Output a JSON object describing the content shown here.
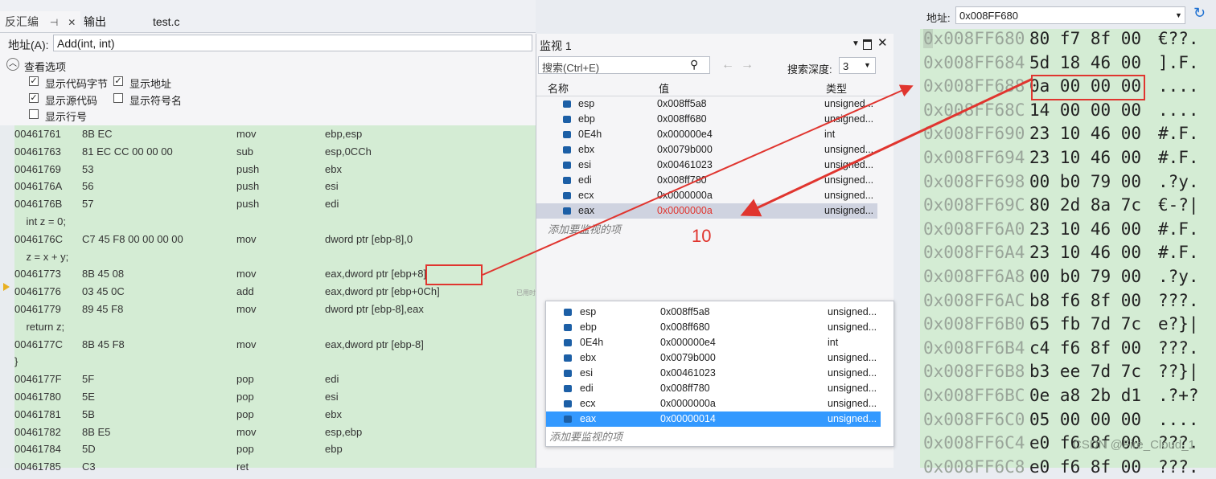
{
  "tabs": {
    "disasm": "反汇编",
    "pin": "⊣",
    "close": "✕",
    "output": "输出",
    "file": "test.c"
  },
  "disasm": {
    "address_label": "地址(A):",
    "address_value": "Add(int, int)",
    "options_header": "查看选项",
    "options": [
      {
        "label": "显示代码字节",
        "checked": true
      },
      {
        "label": "显示地址",
        "checked": true
      },
      {
        "label": "显示源代码",
        "checked": true
      },
      {
        "label": "显示符号名",
        "checked": false
      },
      {
        "label": "显示行号",
        "checked": false
      }
    ],
    "lines": [
      {
        "addr": "00461761",
        "bytes": "8B EC",
        "mn": "mov",
        "op": "ebp,esp"
      },
      {
        "addr": "00461763",
        "bytes": "81 EC CC 00 00 00",
        "mn": "sub",
        "op": "esp,0CCh"
      },
      {
        "addr": "00461769",
        "bytes": "53",
        "mn": "push",
        "op": "ebx"
      },
      {
        "addr": "0046176A",
        "bytes": "56",
        "mn": "push",
        "op": "esi"
      },
      {
        "addr": "0046176B",
        "bytes": "57",
        "mn": "push",
        "op": "edi"
      },
      {
        "src": "    int z = 0;"
      },
      {
        "addr": "0046176C",
        "bytes": "C7 45 F8 00 00 00 00",
        "mn": "mov",
        "op": "dword ptr [ebp-8],0"
      },
      {
        "src": "    z = x + y;"
      },
      {
        "addr": "00461773",
        "bytes": "8B 45 08",
        "mn": "mov",
        "op": "eax,dword ptr [ebp+8]"
      },
      {
        "addr": "00461776",
        "bytes": "03 45 0C",
        "mn": "add",
        "op": "eax,dword ptr [ebp+0Ch]"
      },
      {
        "addr": "00461779",
        "bytes": "89 45 F8",
        "mn": "mov",
        "op": "dword ptr [ebp-8],eax"
      },
      {
        "src": "    return z;"
      },
      {
        "addr": "0046177C",
        "bytes": "8B 45 F8",
        "mn": "mov",
        "op": "eax,dword ptr [ebp-8]"
      },
      {
        "src": "}"
      },
      {
        "addr": "0046177F",
        "bytes": "5F",
        "mn": "pop",
        "op": "edi"
      },
      {
        "addr": "00461780",
        "bytes": "5E",
        "mn": "pop",
        "op": "esi"
      },
      {
        "addr": "00461781",
        "bytes": "5B",
        "mn": "pop",
        "op": "ebx"
      },
      {
        "addr": "00461782",
        "bytes": "8B E5",
        "mn": "mov",
        "op": "esp,ebp"
      },
      {
        "addr": "00461784",
        "bytes": "5D",
        "mn": "pop",
        "op": "ebp"
      },
      {
        "addr": "00461785",
        "bytes": "C3",
        "mn": "ret",
        "op": ""
      }
    ],
    "side_hint": "已用时"
  },
  "watch1": {
    "title": "监视 1",
    "search_placeholder": "搜索(Ctrl+E)",
    "depth_label": "搜索深度:",
    "depth_value": "3",
    "col_name": "名称",
    "col_value": "值",
    "col_type": "类型",
    "rows": [
      {
        "name": "esp",
        "value": "0x008ff5a8",
        "type": "unsigned..."
      },
      {
        "name": "ebp",
        "value": "0x008ff680",
        "type": "unsigned..."
      },
      {
        "name": "0E4h",
        "value": "0x000000e4",
        "type": "int"
      },
      {
        "name": "ebx",
        "value": "0x0079b000",
        "type": "unsigned..."
      },
      {
        "name": "esi",
        "value": "0x00461023",
        "type": "unsigned..."
      },
      {
        "name": "edi",
        "value": "0x008ff780",
        "type": "unsigned..."
      },
      {
        "name": "ecx",
        "value": "0x0000000a",
        "type": "unsigned..."
      },
      {
        "name": "eax",
        "value": "0x0000000a",
        "type": "unsigned..."
      }
    ],
    "add_hint": "添加要监视的项"
  },
  "watch2": {
    "rows": [
      {
        "name": "esp",
        "value": "0x008ff5a8",
        "type": "unsigned..."
      },
      {
        "name": "ebp",
        "value": "0x008ff680",
        "type": "unsigned..."
      },
      {
        "name": "0E4h",
        "value": "0x000000e4",
        "type": "int"
      },
      {
        "name": "ebx",
        "value": "0x0079b000",
        "type": "unsigned..."
      },
      {
        "name": "esi",
        "value": "0x00461023",
        "type": "unsigned..."
      },
      {
        "name": "edi",
        "value": "0x008ff780",
        "type": "unsigned..."
      },
      {
        "name": "ecx",
        "value": "0x0000000a",
        "type": "unsigned..."
      },
      {
        "name": "eax",
        "value": "0x00000014",
        "type": "unsigned..."
      }
    ],
    "add_hint": "添加要监视的项"
  },
  "annotation": {
    "value_label": "10"
  },
  "memory": {
    "address_label": "地址:",
    "address_value": "0x008FF680",
    "rows": [
      {
        "addr": "0x008FF680",
        "bytes": "80 f7 8f 00",
        "chars": "€??."
      },
      {
        "addr": "0x008FF684",
        "bytes": "5d 18 46 00",
        "chars": "].F."
      },
      {
        "addr": "0x008FF688",
        "bytes": "0a 00 00 00",
        "chars": "...."
      },
      {
        "addr": "0x008FF68C",
        "bytes": "14 00 00 00",
        "chars": "...."
      },
      {
        "addr": "0x008FF690",
        "bytes": "23 10 46 00",
        "chars": "#.F."
      },
      {
        "addr": "0x008FF694",
        "bytes": "23 10 46 00",
        "chars": "#.F."
      },
      {
        "addr": "0x008FF698",
        "bytes": "00 b0 79 00",
        "chars": ".?y."
      },
      {
        "addr": "0x008FF69C",
        "bytes": "80 2d 8a 7c",
        "chars": "€-?|"
      },
      {
        "addr": "0x008FF6A0",
        "bytes": "23 10 46 00",
        "chars": "#.F."
      },
      {
        "addr": "0x008FF6A4",
        "bytes": "23 10 46 00",
        "chars": "#.F."
      },
      {
        "addr": "0x008FF6A8",
        "bytes": "00 b0 79 00",
        "chars": ".?y."
      },
      {
        "addr": "0x008FF6AC",
        "bytes": "b8 f6 8f 00",
        "chars": "???."
      },
      {
        "addr": "0x008FF6B0",
        "bytes": "65 fb 7d 7c",
        "chars": "e?}|"
      },
      {
        "addr": "0x008FF6B4",
        "bytes": "c4 f6 8f 00",
        "chars": "???."
      },
      {
        "addr": "0x008FF6B8",
        "bytes": "b3 ee 7d 7c",
        "chars": "??}|"
      },
      {
        "addr": "0x008FF6BC",
        "bytes": "0e a8 2b d1",
        "chars": ".?+?"
      },
      {
        "addr": "0x008FF6C0",
        "bytes": "05 00 00 00",
        "chars": "...."
      },
      {
        "addr": "0x008FF6C4",
        "bytes": "e0 f6 8f 00",
        "chars": "???."
      },
      {
        "addr": "0x008FF6C8",
        "bytes": "e0 f6 8f 00",
        "chars": "???."
      }
    ]
  },
  "watermark": "CSDN @Fire_Cloud_1",
  "colors": {
    "highlight_red": "#e0352f",
    "code_bg": "#d4ecd4",
    "selection": "#3399ff"
  }
}
